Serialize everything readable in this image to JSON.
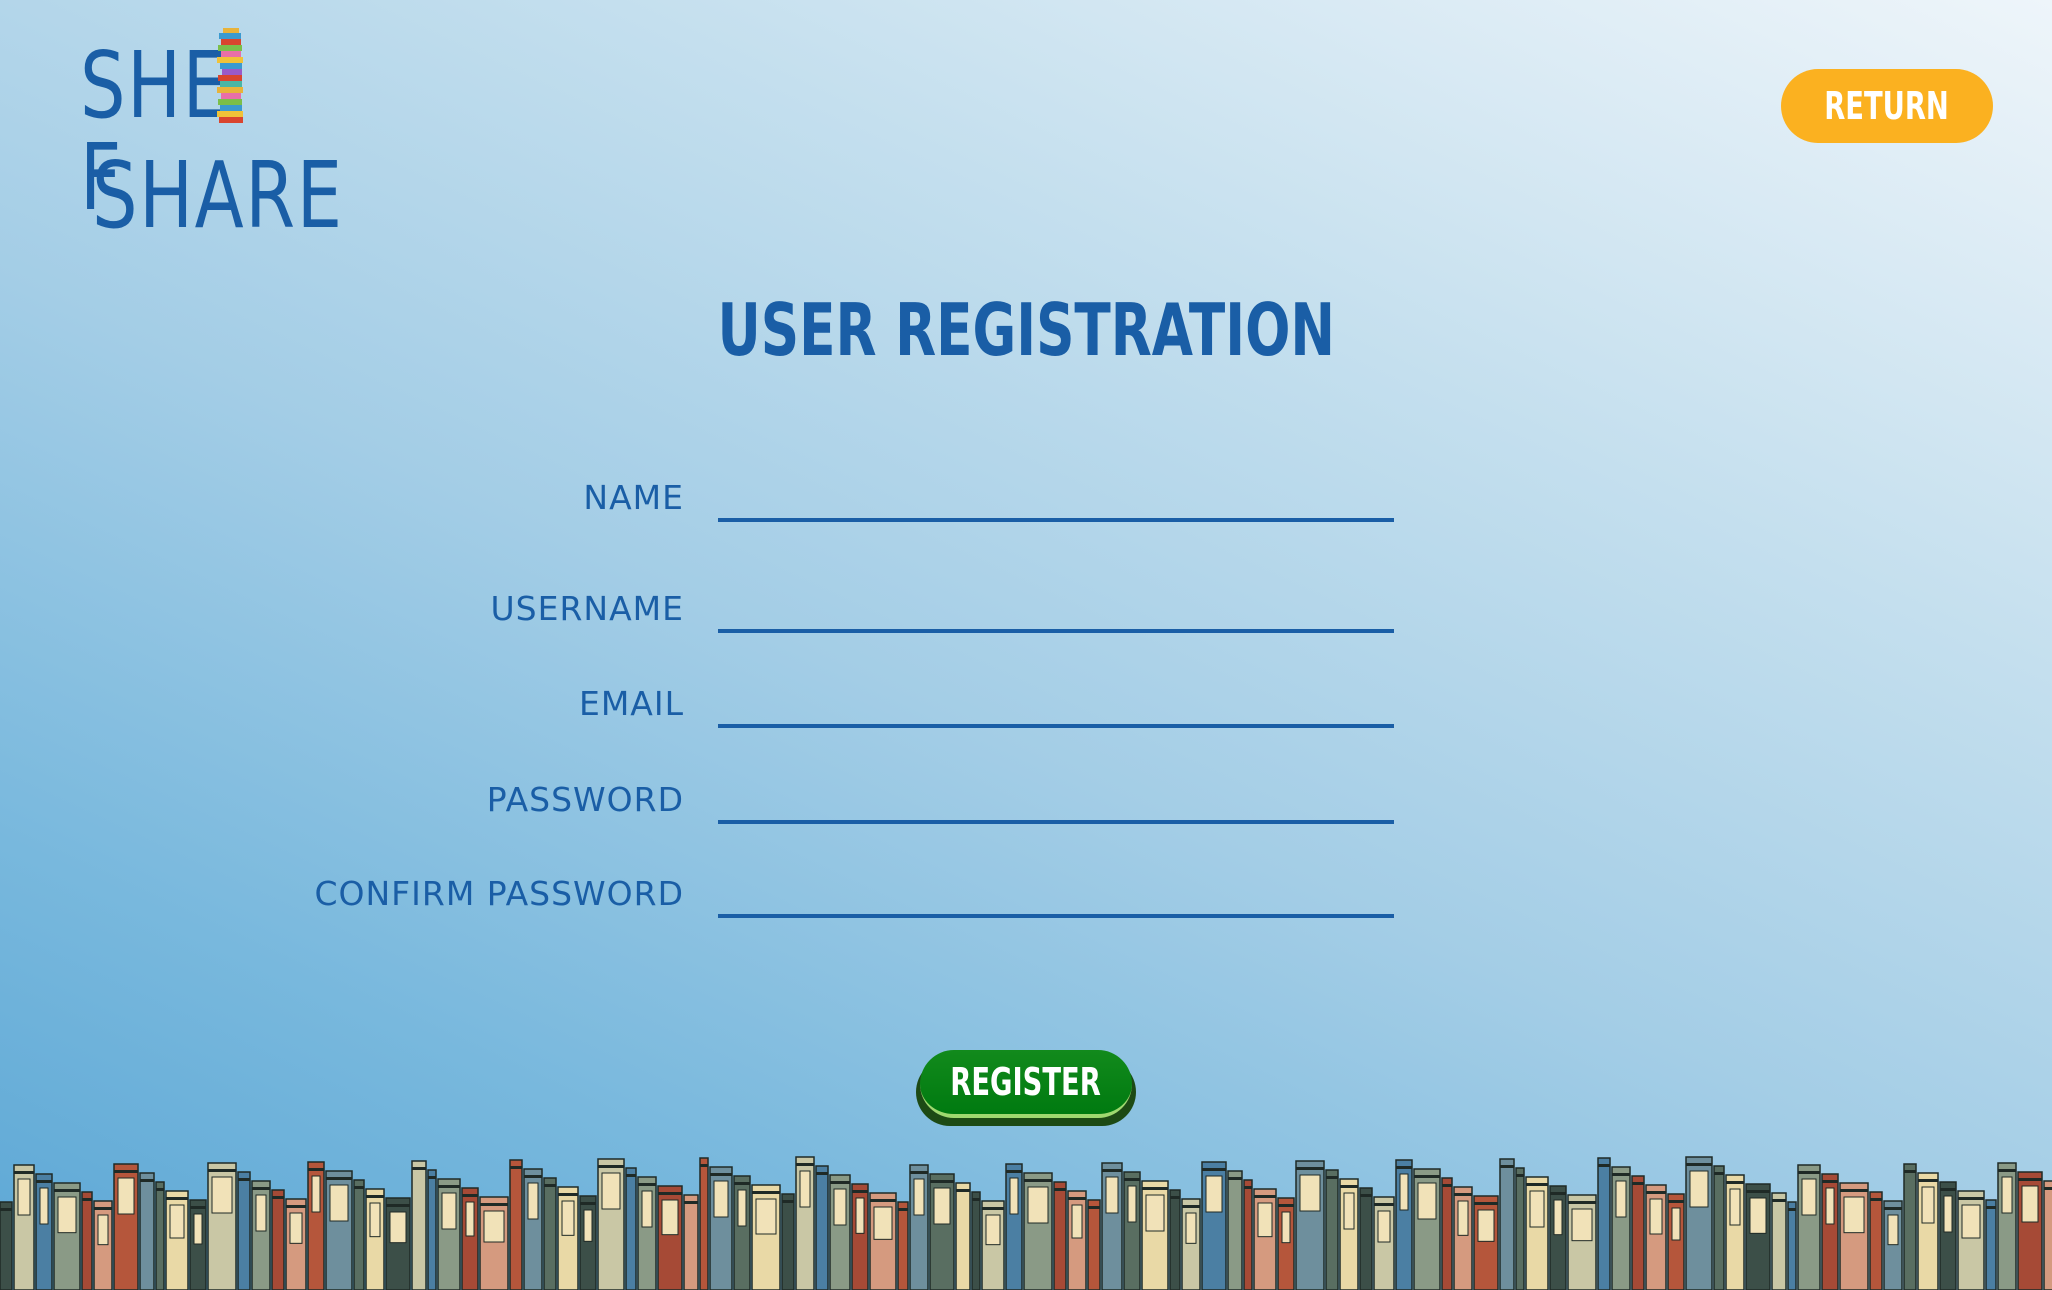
{
  "logo": {
    "line1_left": "SHE",
    "line1_right": "F",
    "line2": "SHARE",
    "icon": "book-stack-icon"
  },
  "header": {
    "return_label": "RETURN"
  },
  "page": {
    "title": "USER REGISTRATION"
  },
  "form": {
    "fields": [
      {
        "label": "NAME",
        "value": ""
      },
      {
        "label": "USERNAME",
        "value": ""
      },
      {
        "label": "EMAIL",
        "value": ""
      },
      {
        "label": "PASSWORD",
        "value": ""
      },
      {
        "label": "CONFIRM PASSWORD",
        "value": ""
      }
    ],
    "submit_label": "REGISTER"
  },
  "colors": {
    "brand_blue": "#1a5ea6",
    "return_button": "#fbb120",
    "register_button": "#007a10",
    "background_light": "#eef5fa",
    "background_dark": "#5ca7d5"
  },
  "decor": {
    "footer": "bookshelf-illustration"
  }
}
